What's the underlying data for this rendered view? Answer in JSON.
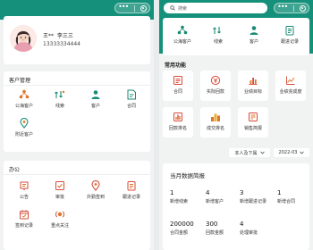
{
  "colors": {
    "accent": "#15907a",
    "icon_orange": "#e0742a",
    "icon_green": "#1a8a74",
    "icon_red": "#d64b3a"
  },
  "profile": {
    "name": "王**  李三三",
    "phone": "13333334444"
  },
  "customer_mgmt": {
    "title": "客户管理",
    "items": [
      {
        "label": "公海客户",
        "icon": "sea-customer-icon"
      },
      {
        "label": "线索",
        "icon": "clue-icon"
      },
      {
        "label": "客户",
        "icon": "customer-icon"
      },
      {
        "label": "合同",
        "icon": "contract-icon"
      },
      {
        "label": "附近客户",
        "icon": "nearby-customer-icon"
      }
    ]
  },
  "office": {
    "title": "办公",
    "items": [
      {
        "label": "公告",
        "icon": "notice-icon"
      },
      {
        "label": "审批",
        "icon": "approval-icon"
      },
      {
        "label": "外勤签到",
        "icon": "field-checkin-icon"
      },
      {
        "label": "跟进记录",
        "icon": "followup-icon"
      },
      {
        "label": "签到记录",
        "icon": "checkin-record-icon"
      },
      {
        "label": "重点关注",
        "icon": "focus-icon"
      }
    ]
  },
  "search": {
    "placeholder": "搜索"
  },
  "quick_nav": [
    {
      "label": "公海客户",
      "icon": "sea-customer-icon"
    },
    {
      "label": "线索",
      "icon": "clue-icon"
    },
    {
      "label": "客户",
      "icon": "customer-icon"
    },
    {
      "label": "跟进记录",
      "icon": "followup-icon"
    }
  ],
  "common_functions": {
    "title": "常用功能",
    "items": [
      {
        "label": "合同",
        "icon": "contract-icon"
      },
      {
        "label": "实际回款",
        "icon": "payment-icon"
      },
      {
        "label": "业绩目标",
        "icon": "target-icon"
      },
      {
        "label": "业绩完成度",
        "icon": "completion-icon"
      },
      {
        "label": "回款排名",
        "icon": "payment-rank-icon"
      },
      {
        "label": "成交排名",
        "icon": "deal-rank-icon"
      },
      {
        "label": "销售简报",
        "icon": "sales-brief-icon"
      }
    ]
  },
  "filters": {
    "scope": "本人及下属",
    "month": "2022-03"
  },
  "monthly": {
    "title": "当月数据简报",
    "stats": [
      {
        "value": "1",
        "label": "新增线索"
      },
      {
        "value": "4",
        "label": "新增客户"
      },
      {
        "value": "3",
        "label": "新增跟进记录"
      },
      {
        "value": "1",
        "label": "新增合同"
      },
      {
        "value": "200000",
        "label": "合同金额"
      },
      {
        "value": "300",
        "label": "回款金额"
      },
      {
        "value": "4",
        "label": "处理审批"
      }
    ]
  }
}
